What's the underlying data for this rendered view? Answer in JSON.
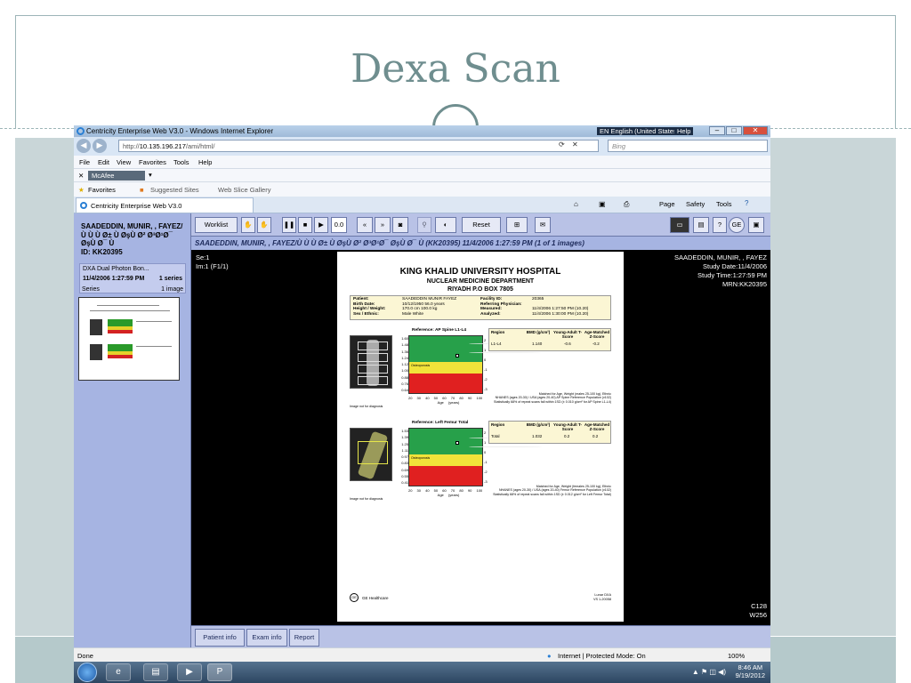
{
  "slide": {
    "title": "Dexa Scan"
  },
  "browser": {
    "window_title": "Centricity Enterprise Web V3.0 - Windows Internet Explorer",
    "language": "EN English (United States)",
    "help": "Help",
    "url_prefix": "http://",
    "url_host": "10.135.196.217",
    "url_path": "/ami/html/",
    "search_placeholder": "Bing",
    "menu": [
      "File",
      "Edit",
      "View",
      "Favorites",
      "Tools",
      "Help"
    ],
    "mcafee": "McAfee",
    "favorites_label": "Favorites",
    "suggested_sites": "Suggested Sites",
    "web_slice": "Web Slice Gallery",
    "tab_label": "Centricity Enterprise Web V3.0",
    "page_menu": "Page",
    "safety_menu": "Safety",
    "tools_menu": "Tools",
    "status_left": "Done",
    "status_zone": "Internet | Protected Mode: On",
    "zoom": "100%",
    "clock_time": "8:46 AM",
    "clock_date": "9/19/2012"
  },
  "patient": {
    "name_block": "SAADEDDIN, MUNIR, , FAYEZ/Ù Ù Ù Ø± Ù ØşÙ Ø² Ø³Ø¹Ø¯ ØşÙ Ø¯ Ù",
    "id": "ID: KK20395",
    "study_desc": "DXA Dual Photon Bon...",
    "study_datetime": "11/4/2006 1:27:59 PM",
    "study_series": "1 series",
    "series_label": "Series",
    "series_count": "1 image"
  },
  "toolbar": {
    "worklist": "Worklist",
    "frame_value": "0.0",
    "reset": "Reset"
  },
  "viewer": {
    "header": "SAADEDDIN, MUNIR, , FAYEZ/Ù Ù Ù Ø± Ù ØşÙ Ø² Ø³Ø¹Ø¯ ØşÙ Ø¯ Ù  (KK20395) 11/4/2006 1:27:59 PM (1 of 1 images)",
    "se": "Se:1",
    "im": "Im:1 (F1/1)",
    "tr_name": "SAADEDDIN, MUNIR, , FAYEZ",
    "tr_date": "Study Date:11/4/2006",
    "tr_time": "Study Time:1:27:59 PM",
    "tr_mrn": "MRN:KK20395",
    "c": "C128",
    "w": "W256"
  },
  "report": {
    "hospital": "KING KHALID UNIVERSITY HOSPITAL",
    "dept": "NUCLEAR MEDICINE DEPARTMENT",
    "address": "RIYADH P.O BOX 7805",
    "patient_label": "Patient:",
    "patient_value": "SAADEDDIN MUNIR FAYEZ",
    "birth_label": "Birth Date:",
    "birth_value": "10/12/1950  56.0 years",
    "hw_label": "Height / Weight:",
    "hw_value": "170.0 cm   100.0 kg",
    "sex_label": "Sex / Ethnic:",
    "sex_value": "Male   White",
    "facility_label": "Facility ID:",
    "facility_value": "20365",
    "referring_label": "Referring Physician:",
    "measured_label": "Measured:",
    "measured_value": "11/4/2006   1:27:50 PM   (10.20)",
    "analyzed_label": "Analyzed:",
    "analyzed_value": "11/4/2006   1:30:00 PM   (10.20)",
    "spine_title": "Reference: AP Spine L1-L4",
    "femur_title": "Reference: Left Femur Total",
    "bmd_axis_label": "BMD (g/cm²)",
    "tscore_label": "YA T-Score",
    "age_label": "Age (years)",
    "spine_yticks": [
      "1.60",
      "1.48",
      "1.36",
      "1.24",
      "1.12",
      "1.00",
      "0.88",
      "0.76",
      "0.64"
    ],
    "femur_yticks": [
      "1.53",
      "1.39",
      "1.25",
      "1.11",
      "0.97",
      "0.83",
      "0.69",
      "0.55",
      "0.41"
    ],
    "tticks": [
      "2",
      "1",
      "0",
      "-1",
      "-2",
      "-3",
      "-4",
      "-5"
    ],
    "xticks": "20 30 40 50 60 70 80 90 100",
    "col_region": "Region",
    "col_bmd": "BMD (g/cm²)",
    "col_young": "Young-Adult T-Score",
    "col_age": "Age-Matched Z-Score",
    "spine_region": "L1-L4",
    "spine_bmd": "1.140",
    "spine_t": "-0.6",
    "spine_z": "-0.2",
    "femur_region": "Total",
    "femur_bmd": "1.032",
    "femur_t": "0.2",
    "femur_z": "0.2",
    "spine_note1": "Matched for Age, Weight (males 25-100 kg), Ethnic",
    "spine_note2": "NHANES (ages 20-30) / USA (ages 20-40) AP Spine Reference Population (v102)",
    "spine_note3": "Statistically 68% of repeat scans fall within 1SD (± 0.010 g/cm² for AP Spine L1-L4)",
    "femur_note1": "Matched for Age, Weight (females 25-100 kg), Ethnic",
    "femur_note2": "NHANES (ages 20-30) / USA (ages 20-40) Femur Reference Population (v102)",
    "femur_note3": "Statistically 68% of repeat scans fall within 1SD (± 0.012 g/cm² for Left Femur Total)",
    "image_note": "Image not for diagnosis",
    "osteoporosis": "Osteoporosis",
    "ge_healthcare": "GE Healthcare",
    "footer": "Lunar DXA\nVS 1-20058"
  },
  "app_tabs": [
    "Patient info",
    "Exam info",
    "Report"
  ],
  "colors": {
    "normal": "#27a04a",
    "osteopenia": "#f1e33a",
    "osteoporosis": "#e02020"
  }
}
